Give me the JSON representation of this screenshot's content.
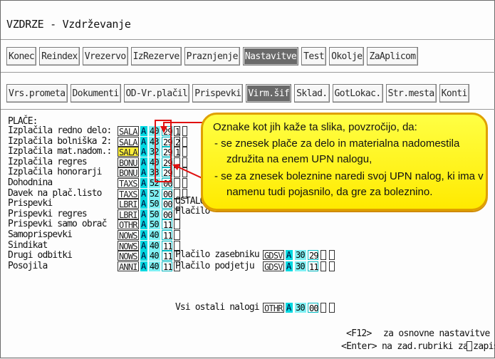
{
  "window": {
    "title": "VZDRZE - Vzdrževanje"
  },
  "toolbar1": [
    "Konec",
    "Reindex",
    "Vrezervo",
    "IzRezerve",
    "Praznjenje",
    "Nastavitve",
    "Test",
    "Okolje",
    "ZaAplicom"
  ],
  "toolbar2": [
    "Vrs.prometa",
    "Dokumenti",
    "OD-Vr.plačil",
    "Prispevki",
    "Virm.šif",
    "Sklad.",
    "GotLokac.",
    "Str.mesta",
    "Konti"
  ],
  "section": {
    "title": "PLAČE:"
  },
  "rows": [
    {
      "label": "Izplačila redno delo:",
      "code": "SALA",
      "a": "A",
      "n1": "40",
      "n2": "29",
      "n3": "1"
    },
    {
      "label": "Izplačila bolniška 2:",
      "code": "SALA",
      "a": "A",
      "n1": "43",
      "n2": "29",
      "n3": "2"
    },
    {
      "label": "Izplačila mat.nadom.:",
      "code": "SALA",
      "a": "A",
      "n1": "32",
      "n2": "29",
      "n3": "1"
    },
    {
      "label": "Izplačila regres",
      "code": "BONU",
      "a": "A",
      "n1": "40",
      "n2": "29",
      "n3": ""
    },
    {
      "label": "Izplačila honorarji",
      "code": "BONU",
      "a": "A",
      "n1": "33",
      "n2": "29",
      "n3": ""
    },
    {
      "label": "Dohodnina",
      "code": "TAXS",
      "a": "A",
      "n1": "52",
      "n2": "00",
      "n3": ""
    },
    {
      "label": "Davek na plač.listo",
      "code": "TAXS",
      "a": "A",
      "n1": "52",
      "n2": "00",
      "n3": ""
    },
    {
      "label": "Prispevki",
      "code": "LBRI",
      "a": "A",
      "n1": "50",
      "n2": "00",
      "n3": ""
    },
    {
      "label": "Prispevki regres",
      "code": "LBRI",
      "a": "A",
      "n1": "50",
      "n2": "00",
      "n3": ""
    },
    {
      "label": "Prispevki samo obrač",
      "code": "OTHR",
      "a": "A",
      "n1": "50",
      "n2": "11",
      "n3": ""
    },
    {
      "label": "Samoprispevki",
      "code": "NOWS",
      "a": "A",
      "n1": "40",
      "n2": "11",
      "n3": ""
    },
    {
      "label": "Sindikat",
      "code": "NOWS",
      "a": "A",
      "n1": "40",
      "n2": "11",
      "n3": ""
    },
    {
      "label": "Drugi odbitki",
      "code": "NOWS",
      "a": "A",
      "n1": "40",
      "n2": "11",
      "n3": ""
    },
    {
      "label": "Posojila",
      "code": "ANNI",
      "a": "A",
      "n1": "40",
      "n2": "11",
      "n3": ""
    }
  ],
  "right": {
    "ostalo": "OSTALO",
    "placilo_cut": "Plačilo",
    "rows": [
      {
        "label": "Plačilo zasebniku",
        "code": "GDSV",
        "a": "A",
        "n1": "30",
        "n2": "29"
      },
      {
        "label": "Plačilo podjetju",
        "code": "GDSV",
        "a": "A",
        "n1": "30",
        "n2": "11"
      },
      {
        "label": "Vsi ostali nalogi",
        "code": "OTHR",
        "a": "A",
        "n1": "30",
        "n2": "00"
      }
    ]
  },
  "callout": {
    "line1": "Oznake kot jih kaže ta slika, povzročijo, da:",
    "line2": "- se znesek plače za delo in materialna nadomestila",
    "line3": "združita na enem UPN nalogu,",
    "line4": "- se za znesek boleznine naredi svoj UPN nalog, ki ima v",
    "line5": "namenu tudi pojasnilo, da gre za boleznino."
  },
  "hints": {
    "f12_key": "<F12>",
    "f12_text": "za osnovne nastavitve",
    "enter_key": "<Enter>",
    "enter_text": "na zad.rubriki za zapis"
  },
  "colors": {
    "accent_cyan": "#00d8e0",
    "callout_yellow": "#ffff44",
    "highlight_red": "#e01010",
    "selected_button": "#6a6a6a"
  }
}
